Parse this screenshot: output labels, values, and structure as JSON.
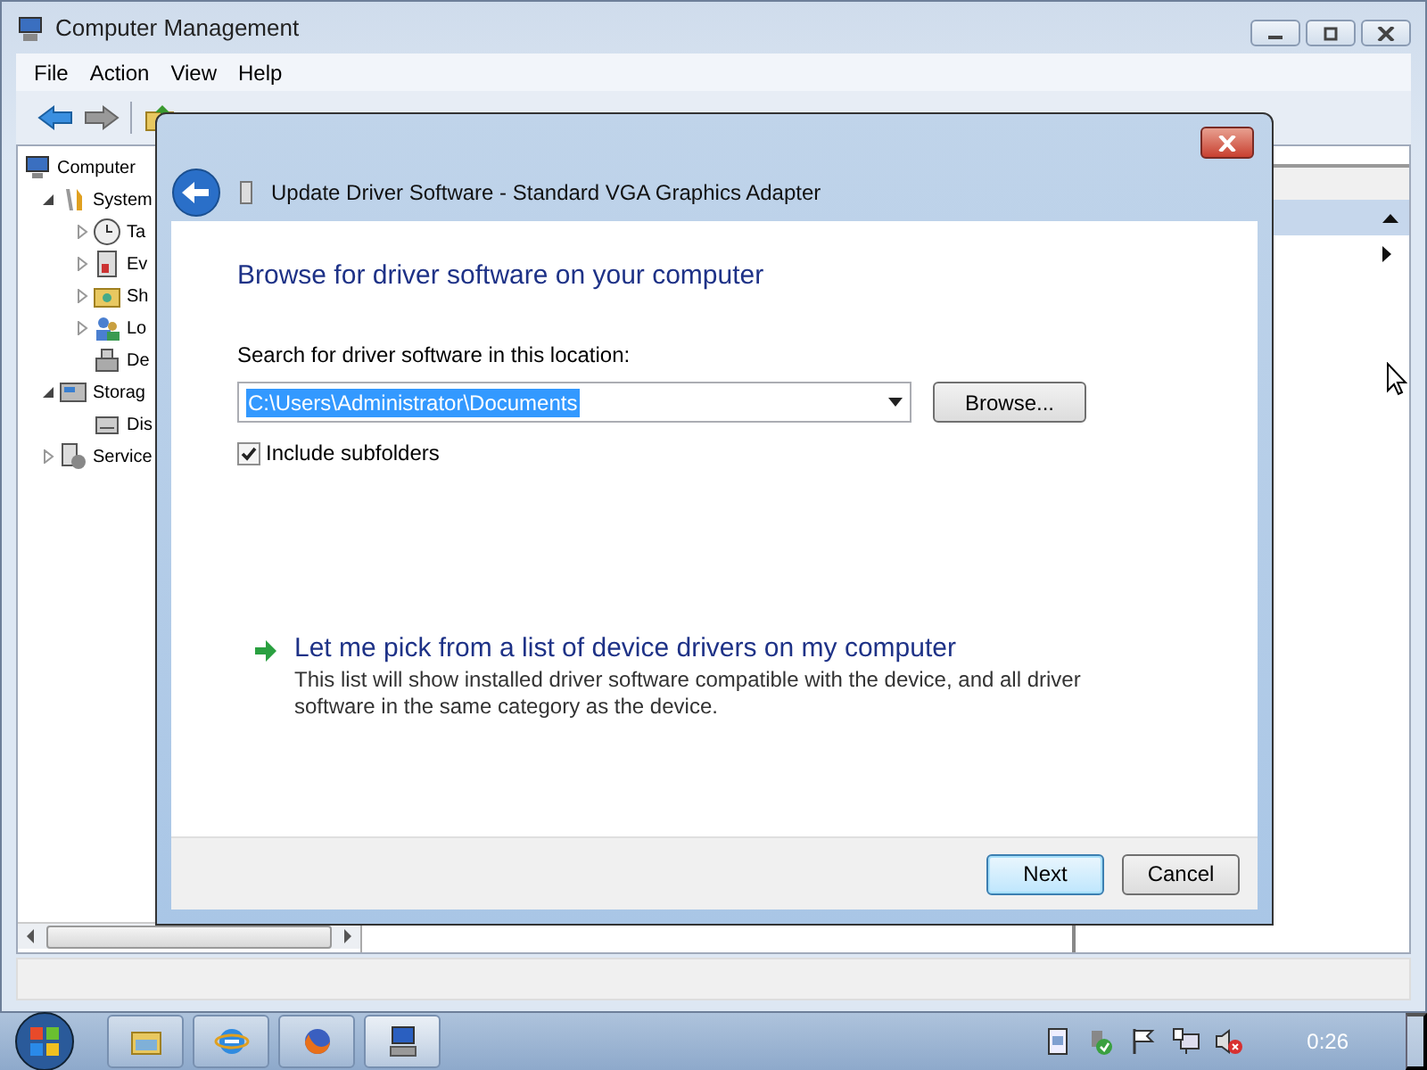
{
  "window": {
    "title": "Computer Management"
  },
  "menu": [
    {
      "label": "File"
    },
    {
      "label": "Action"
    },
    {
      "label": "View"
    },
    {
      "label": "Help"
    }
  ],
  "toolbar": [
    {
      "kind": "back"
    },
    {
      "kind": "forward"
    },
    {
      "kind": "up"
    }
  ],
  "tree": [
    {
      "label": "Computer",
      "kind": "computer",
      "expandable": false,
      "children": [
        {
          "label": "System",
          "kind": "tools",
          "expandable": true,
          "expanded": true,
          "children": [
            {
              "label": "Ta",
              "kind": "clock",
              "expandable": true,
              "expanded": false
            },
            {
              "label": "Ev",
              "kind": "log",
              "expandable": true,
              "expanded": false
            },
            {
              "label": "Sh",
              "kind": "share",
              "expandable": true,
              "expanded": false
            },
            {
              "label": "Lo",
              "kind": "users",
              "expandable": true,
              "expanded": false
            },
            {
              "label": "De",
              "kind": "device",
              "expandable": false
            }
          ]
        },
        {
          "label": "Storag",
          "kind": "storage",
          "expandable": true,
          "expanded": true,
          "children": [
            {
              "label": "Dis",
              "kind": "disk",
              "expandable": false
            }
          ]
        },
        {
          "label": "Service",
          "kind": "services",
          "expandable": true,
          "expanded": false
        }
      ]
    }
  ],
  "dialog": {
    "title": "Update Driver Software - Standard VGA Graphics Adapter",
    "heading": "Browse for driver software on your computer",
    "search_label": "Search for driver software in this location:",
    "path_field": {
      "value": "C:\\Users\\Administrator\\Documents",
      "text_selected": true
    },
    "browse_button": "Browse...",
    "include_subfolders": {
      "label": "Include subfolders",
      "checked": true
    },
    "pick_link": {
      "title": "Let me pick from a list of device drivers on my computer",
      "description": "This list will show installed driver software compatible with the device, and all driver software in the same category as the device."
    },
    "buttons": [
      {
        "label": "Next",
        "default": true
      },
      {
        "label": "Cancel",
        "default": false
      }
    ]
  },
  "taskbar": {
    "pinned": [
      {
        "kind": "folder",
        "active": false
      },
      {
        "kind": "browser",
        "active": false
      },
      {
        "kind": "fox",
        "active": false
      },
      {
        "kind": "console",
        "active": true
      }
    ],
    "tray": [
      {
        "kind": "document"
      },
      {
        "kind": "shield"
      },
      {
        "kind": "flag"
      },
      {
        "kind": "network"
      },
      {
        "kind": "muted"
      }
    ],
    "clock": "0:26"
  }
}
